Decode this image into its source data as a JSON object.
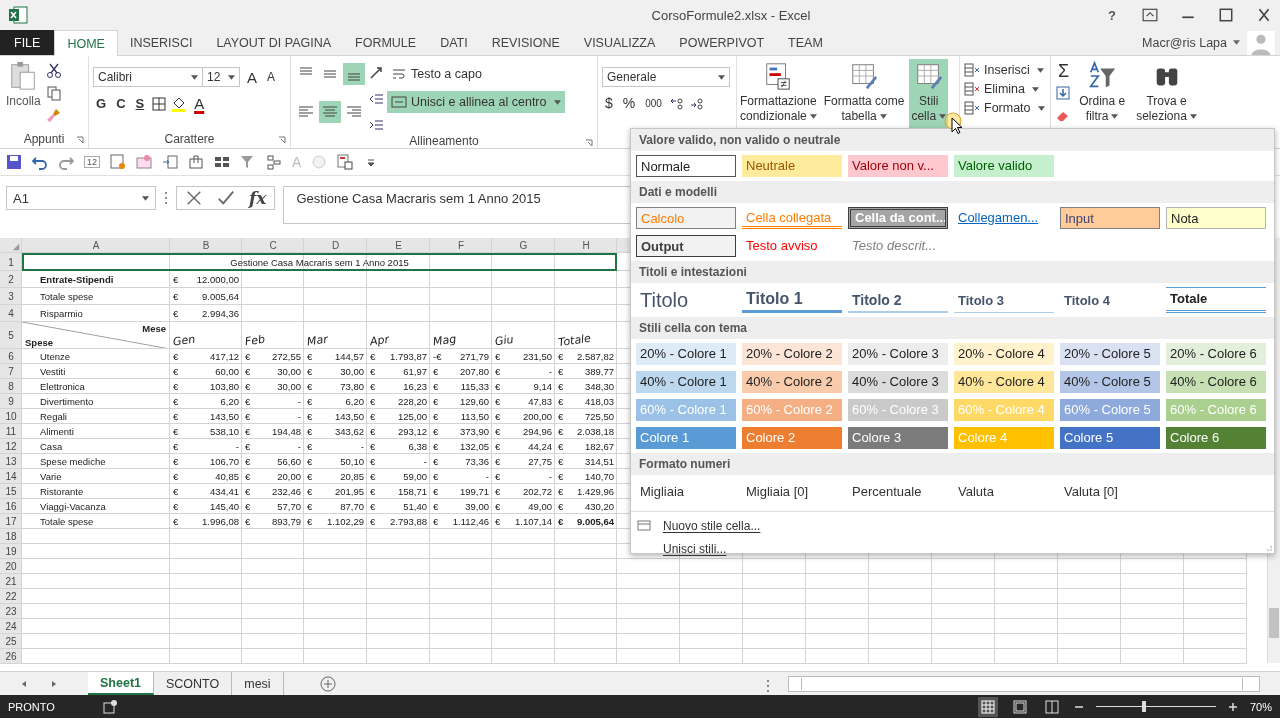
{
  "window": {
    "title": "CorsoFormule2.xlsx - Excel",
    "help": "?"
  },
  "tabs": [
    {
      "label": "FILE",
      "kind": "file",
      "selected": false
    },
    {
      "label": "HOME",
      "kind": "tab",
      "selected": true
    },
    {
      "label": "INSERISCI",
      "kind": "tab",
      "selected": false
    },
    {
      "label": "LAYOUT DI PAGINA",
      "kind": "tab",
      "selected": false
    },
    {
      "label": "FORMULE",
      "kind": "tab",
      "selected": false
    },
    {
      "label": "DATI",
      "kind": "tab",
      "selected": false
    },
    {
      "label": "REVISIONE",
      "kind": "tab",
      "selected": false
    },
    {
      "label": "VISUALIZZA",
      "kind": "tab",
      "selected": false
    },
    {
      "label": "POWERPIVOT",
      "kind": "tab",
      "selected": false
    },
    {
      "label": "TEAM",
      "kind": "tab",
      "selected": false
    }
  ],
  "user": {
    "name": "Macr@ris Lapa"
  },
  "ribbon": {
    "clipboard": {
      "paste": "Incolla",
      "group": "Appunti"
    },
    "font": {
      "name": "Calibri",
      "size": "12",
      "grow": "A",
      "shrink": "A",
      "bold": "G",
      "italic": "C",
      "underline": "S",
      "color_letter": "A",
      "group": "Carattere"
    },
    "alignment": {
      "buttons": [
        {
          "kind": "top",
          "selected": false
        },
        {
          "kind": "middle",
          "selected": false
        },
        {
          "kind": "bottom",
          "selected": true
        },
        {
          "kind": "left",
          "selected": false
        },
        {
          "kind": "center",
          "selected": true
        },
        {
          "kind": "right",
          "selected": false
        }
      ],
      "wrap": {
        "label": "Testo a capo",
        "selected": false
      },
      "merge": {
        "label": "Unisci e allinea al centro",
        "selected": true
      },
      "group": "Allineamento"
    },
    "number": {
      "format": "Generale",
      "currency": "$",
      "percent": "%",
      "thousands": "000"
    },
    "styles": [
      {
        "lines": [
          "Formattazione",
          "condizionale"
        ],
        "kind": "conditional",
        "selected": false
      },
      {
        "lines": [
          "Formatta come",
          "tabella"
        ],
        "kind": "table",
        "selected": false
      },
      {
        "lines": [
          "Stili",
          "cella"
        ],
        "kind": "cell",
        "selected": true
      }
    ],
    "cells": [
      "Inserisci",
      "Elimina",
      "Formato"
    ],
    "sum": "Σ",
    "editing": [
      {
        "lines": [
          "Ordina e",
          "filtra"
        ],
        "kind": "sort"
      },
      {
        "lines": [
          "Trova e",
          "seleziona"
        ],
        "kind": "find"
      }
    ]
  },
  "quick_access": {
    "badge": "12",
    "letter": "A"
  },
  "formula_bar": {
    "name_box": "A1",
    "fx": "fx",
    "formula": "Gestione Casa Macraris sem 1 Anno 2015"
  },
  "columns": [
    "A",
    "B",
    "C",
    "D",
    "E",
    "F",
    "G",
    "H"
  ],
  "rows": [
    {
      "n": "1",
      "kind": "title",
      "text": "Gestione Casa Macraris sem 1 Anno 2015"
    },
    {
      "n": "2",
      "kind": "summary",
      "label": "Entrate-Stipendi",
      "bold": true,
      "value": [
        "€",
        "12.000,00"
      ]
    },
    {
      "n": "3",
      "kind": "summary",
      "label": "Totale spese",
      "bold": false,
      "value": [
        "€",
        "9.005,64"
      ]
    },
    {
      "n": "4",
      "kind": "summary",
      "label": "Risparmio",
      "bold": false,
      "value": [
        "€",
        "2.994,36"
      ]
    },
    {
      "n": "5",
      "kind": "header",
      "row_label": "Spese",
      "col_label": "Mese",
      "months": [
        "Gen",
        "Feb",
        "Mar",
        "Apr",
        "Mag",
        "Giu",
        "Totale"
      ]
    },
    {
      "n": "6",
      "kind": "data",
      "label": "Utenze",
      "last_bold": false,
      "cells": [
        [
          "€",
          "417,12"
        ],
        [
          "€",
          "272,55"
        ],
        [
          "€",
          "144,57"
        ],
        [
          "€",
          "1.793,87"
        ],
        [
          "-€",
          "271,79"
        ],
        [
          "€",
          "231,50"
        ],
        [
          "€",
          "2.587,82"
        ]
      ]
    },
    {
      "n": "7",
      "kind": "data",
      "label": "Vestiti",
      "last_bold": false,
      "cells": [
        [
          "€",
          "60,00"
        ],
        [
          "€",
          "30,00"
        ],
        [
          "€",
          "30,00"
        ],
        [
          "€",
          "61,97"
        ],
        [
          "€",
          "207,80"
        ],
        [
          "€",
          "-"
        ],
        [
          "€",
          "389,77"
        ]
      ]
    },
    {
      "n": "8",
      "kind": "data",
      "label": "Elettronica",
      "last_bold": false,
      "cells": [
        [
          "€",
          "103,80"
        ],
        [
          "€",
          "30,00"
        ],
        [
          "€",
          "73,80"
        ],
        [
          "€",
          "16,23"
        ],
        [
          "€",
          "115,33"
        ],
        [
          "€",
          "9,14"
        ],
        [
          "€",
          "348,30"
        ]
      ]
    },
    {
      "n": "9",
      "kind": "data",
      "label": "Divertimento",
      "last_bold": false,
      "cells": [
        [
          "€",
          "6,20"
        ],
        [
          "€",
          "-"
        ],
        [
          "€",
          "6,20"
        ],
        [
          "€",
          "228,20"
        ],
        [
          "€",
          "129,60"
        ],
        [
          "€",
          "47,83"
        ],
        [
          "€",
          "418,03"
        ]
      ]
    },
    {
      "n": "10",
      "kind": "data",
      "label": "Regali",
      "last_bold": false,
      "cells": [
        [
          "€",
          "143,50"
        ],
        [
          "€",
          "-"
        ],
        [
          "€",
          "143,50"
        ],
        [
          "€",
          "125,00"
        ],
        [
          "€",
          "113,50"
        ],
        [
          "€",
          "200,00"
        ],
        [
          "€",
          "725,50"
        ]
      ]
    },
    {
      "n": "11",
      "kind": "data",
      "label": "Alimenti",
      "last_bold": false,
      "cells": [
        [
          "€",
          "538,10"
        ],
        [
          "€",
          "194,48"
        ],
        [
          "€",
          "343,62"
        ],
        [
          "€",
          "293,12"
        ],
        [
          "€",
          "373,90"
        ],
        [
          "€",
          "294,96"
        ],
        [
          "€",
          "2.038,18"
        ]
      ]
    },
    {
      "n": "12",
      "kind": "data",
      "label": "Casa",
      "last_bold": false,
      "cells": [
        [
          "€",
          "-"
        ],
        [
          "€",
          "-"
        ],
        [
          "€",
          "-"
        ],
        [
          "€",
          "6,38"
        ],
        [
          "€",
          "132,05"
        ],
        [
          "€",
          "44,24"
        ],
        [
          "€",
          "182,67"
        ]
      ]
    },
    {
      "n": "13",
      "kind": "data",
      "label": "Spese mediche",
      "last_bold": false,
      "cells": [
        [
          "€",
          "106,70"
        ],
        [
          "€",
          "56,60"
        ],
        [
          "€",
          "50,10"
        ],
        [
          "€",
          "-"
        ],
        [
          "€",
          "73,36"
        ],
        [
          "€",
          "27,75"
        ],
        [
          "€",
          "314,51"
        ]
      ]
    },
    {
      "n": "14",
      "kind": "data",
      "label": "Varie",
      "last_bold": false,
      "cells": [
        [
          "€",
          "40,85"
        ],
        [
          "€",
          "20,00"
        ],
        [
          "€",
          "20,85"
        ],
        [
          "€",
          "59,00"
        ],
        [
          "€",
          "-"
        ],
        [
          "€",
          "-"
        ],
        [
          "€",
          "140,70"
        ]
      ]
    },
    {
      "n": "15",
      "kind": "data",
      "label": "Ristorante",
      "last_bold": false,
      "cells": [
        [
          "€",
          "434,41"
        ],
        [
          "€",
          "232,46"
        ],
        [
          "€",
          "201,95"
        ],
        [
          "€",
          "158,71"
        ],
        [
          "€",
          "199,71"
        ],
        [
          "€",
          "202,72"
        ],
        [
          "€",
          "1.429,96"
        ]
      ]
    },
    {
      "n": "16",
      "kind": "data",
      "label": "Viaggi-Vacanza",
      "last_bold": false,
      "cells": [
        [
          "€",
          "145,40"
        ],
        [
          "€",
          "57,70"
        ],
        [
          "€",
          "87,70"
        ],
        [
          "€",
          "51,40"
        ],
        [
          "€",
          "39,00"
        ],
        [
          "€",
          "49,00"
        ],
        [
          "€",
          "430,20"
        ]
      ]
    },
    {
      "n": "17",
      "kind": "data",
      "label": "Totale spese",
      "last_bold": true,
      "cells": [
        [
          "€",
          "1.996,08"
        ],
        [
          "€",
          "893,79"
        ],
        [
          "€",
          "1.102,29"
        ],
        [
          "€",
          "2.793,88"
        ],
        [
          "€",
          "1.112,46"
        ],
        [
          "€",
          "1.107,14"
        ],
        [
          "€",
          "9.005,64"
        ]
      ]
    },
    {
      "n": "18",
      "kind": "empty"
    },
    {
      "n": "19",
      "kind": "empty"
    },
    {
      "n": "20",
      "kind": "empty"
    },
    {
      "n": "21",
      "kind": "empty"
    },
    {
      "n": "22",
      "kind": "empty"
    },
    {
      "n": "23",
      "kind": "empty"
    },
    {
      "n": "24",
      "kind": "empty"
    },
    {
      "n": "25",
      "kind": "empty"
    },
    {
      "n": "26",
      "kind": "empty"
    }
  ],
  "sheets": [
    {
      "label": "Sheet1",
      "selected": true
    },
    {
      "label": "SCONTO",
      "selected": false
    },
    {
      "label": "mesi",
      "selected": false
    }
  ],
  "status_bar": {
    "text": "PRONTO",
    "zoom": "70%",
    "zoom_slider": {
      "level": 0.4
    }
  },
  "styles_gallery": {
    "sections": [
      {
        "title": "Valore valido, non valido o neutrale",
        "items": [
          {
            "label": "Normale",
            "kind": "normal"
          },
          {
            "label": "Neutrale",
            "kind": "neutral"
          },
          {
            "label": "Valore non v...",
            "kind": "bad"
          },
          {
            "label": "Valore valido",
            "kind": "good"
          }
        ]
      },
      {
        "title": "Dati e modelli",
        "items": [
          {
            "label": "Calcolo",
            "kind": "calc"
          },
          {
            "label": "Cella collegata",
            "kind": "linked"
          },
          {
            "label": "Cella da cont...",
            "kind": "check"
          },
          {
            "label": "Collegamen...",
            "kind": "link"
          },
          {
            "label": "Input",
            "kind": "input"
          },
          {
            "label": "Nota",
            "kind": "note"
          },
          {
            "label": "Output",
            "kind": "output"
          },
          {
            "label": "Testo avviso",
            "kind": "warning"
          },
          {
            "label": "Testo descrit...",
            "kind": "explanatory"
          }
        ]
      },
      {
        "title": "Titoli e intestazioni",
        "items": [
          {
            "label": "Titolo",
            "kind": "title"
          },
          {
            "label": "Titolo 1",
            "kind": "h1"
          },
          {
            "label": "Titolo 2",
            "kind": "h2"
          },
          {
            "label": "Titolo 3",
            "kind": "h3"
          },
          {
            "label": "Titolo 4",
            "kind": "h4"
          },
          {
            "label": "Totale",
            "kind": "total"
          }
        ]
      },
      {
        "title": "Stili cella con tema",
        "items": [
          {
            "label": "20% - Colore 1",
            "kind": "tint",
            "color": "#ddebf7"
          },
          {
            "label": "20% - Colore 2",
            "kind": "tint",
            "color": "#fce4d6"
          },
          {
            "label": "20% - Colore 3",
            "kind": "tint",
            "color": "#ededed"
          },
          {
            "label": "20% - Colore 4",
            "kind": "tint",
            "color": "#fff2cc"
          },
          {
            "label": "20% - Colore 5",
            "kind": "tint",
            "color": "#d9e1f2"
          },
          {
            "label": "20% - Colore 6",
            "kind": "tint",
            "color": "#e2efda"
          },
          {
            "label": "40% - Colore 1",
            "kind": "tint",
            "color": "#bdd7ee"
          },
          {
            "label": "40% - Colore 2",
            "kind": "tint",
            "color": "#f8cbad"
          },
          {
            "label": "40% - Colore 3",
            "kind": "tint",
            "color": "#dbdbdb"
          },
          {
            "label": "40% - Colore 4",
            "kind": "tint",
            "color": "#ffe699"
          },
          {
            "label": "40% - Colore 5",
            "kind": "tint",
            "color": "#b4c6e7"
          },
          {
            "label": "40% - Colore 6",
            "kind": "tint",
            "color": "#c6e0b4"
          },
          {
            "label": "60% - Colore 1",
            "kind": "shade",
            "color": "#9bc2e6"
          },
          {
            "label": "60% - Colore 2",
            "kind": "shade",
            "color": "#f4b084"
          },
          {
            "label": "60% - Colore 3",
            "kind": "shade",
            "color": "#c9c9c9"
          },
          {
            "label": "60% - Colore 4",
            "kind": "shade",
            "color": "#ffd966"
          },
          {
            "label": "60% - Colore 5",
            "kind": "shade",
            "color": "#8ea9db"
          },
          {
            "label": "60% - Colore 6",
            "kind": "shade",
            "color": "#a9d08e"
          },
          {
            "label": "Colore 1",
            "kind": "shade",
            "color": "#5b9bd5"
          },
          {
            "label": "Colore 2",
            "kind": "shade",
            "color": "#ed7d31"
          },
          {
            "label": "Colore 3",
            "kind": "shade",
            "color": "#7b7b7b"
          },
          {
            "label": "Colore 4",
            "kind": "shade",
            "color": "#ffc000"
          },
          {
            "label": "Colore 5",
            "kind": "shade",
            "color": "#4472c4"
          },
          {
            "label": "Colore 6",
            "kind": "shade",
            "color": "#548235"
          }
        ]
      },
      {
        "title": "Formato numeri",
        "items": [
          {
            "label": "Migliaia",
            "kind": "plain"
          },
          {
            "label": "Migliaia [0]",
            "kind": "plain"
          },
          {
            "label": "Percentuale",
            "kind": "plain"
          },
          {
            "label": "Valuta",
            "kind": "plain"
          },
          {
            "label": "Valuta [0]",
            "kind": "plain"
          }
        ]
      }
    ],
    "commands": [
      {
        "label": "Nuovo stile cella...",
        "kind": "new"
      },
      {
        "label": "Unisci stili...",
        "kind": "merge"
      }
    ]
  }
}
